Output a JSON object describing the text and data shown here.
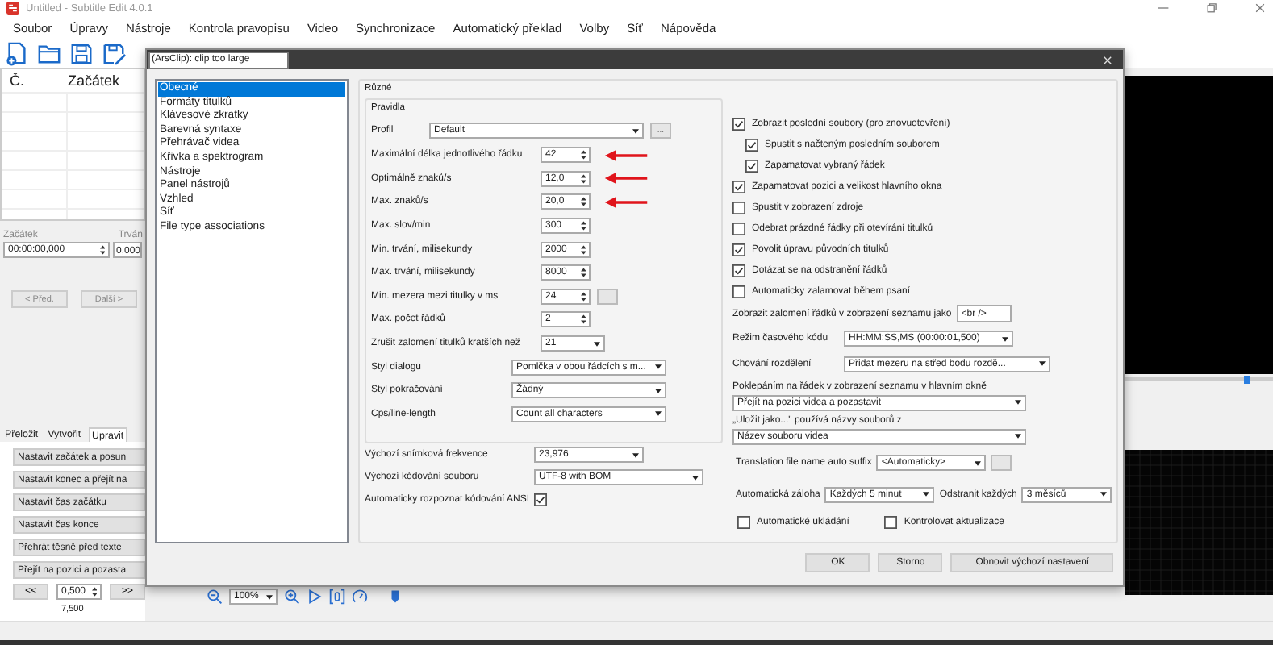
{
  "window": {
    "title": "Untitled - Subtitle Edit 4.0.1"
  },
  "menu": [
    "Soubor",
    "Úpravy",
    "Nástroje",
    "Kontrola pravopisu",
    "Video",
    "Synchronizace",
    "Automatický překlad",
    "Volby",
    "Síť",
    "Nápověda"
  ],
  "subtitle_list": {
    "columns": [
      "Č.",
      "Začátek"
    ]
  },
  "edit_panel": {
    "start_label": "Začátek",
    "duration_label": "Trván",
    "start_value": "00:00:00,000",
    "duration_value": "0,000",
    "buttons": [
      {
        "label": "< Před.",
        "disabled": true
      },
      {
        "label": "Další >",
        "disabled": true
      }
    ]
  },
  "tabs": [
    {
      "label": "Přeložit",
      "selected": false
    },
    {
      "label": "Vytvořit",
      "selected": false
    },
    {
      "label": "Upravit",
      "selected": true
    }
  ],
  "actions": [
    "Nastavit začátek a posun",
    "Nastavit konec a přejít na",
    "Nastavit čas začátku",
    "Nastavit čas konce",
    "Přehrát těsně před texte",
    "Přejít na pozici a pozasta"
  ],
  "nudge": {
    "back": "<<",
    "step": "0,500",
    "forward": ">>",
    "duration": "7,500"
  },
  "zoom": {
    "value": "100%"
  },
  "video_position": {
    "level": 0.8
  },
  "dialog": {
    "clipboard_tip": "(ArsClip): clip too large",
    "categories": [
      {
        "label": "Obecné",
        "selected": true
      },
      {
        "label": "Formáty titulků",
        "selected": false
      },
      {
        "label": "Klávesové zkratky",
        "selected": false
      },
      {
        "label": "Barevná syntaxe",
        "selected": false
      },
      {
        "label": "Přehrávač videa",
        "selected": false
      },
      {
        "label": "Křivka a spektrogram",
        "selected": false
      },
      {
        "label": "Nástroje",
        "selected": false
      },
      {
        "label": "Panel nástrojů",
        "selected": false
      },
      {
        "label": "Vzhled",
        "selected": false
      },
      {
        "label": "Síť",
        "selected": false
      },
      {
        "label": "File type associations",
        "selected": false
      }
    ],
    "group_title": "Různé",
    "rules": {
      "title": "Pravidla",
      "profile": {
        "label": "Profil",
        "value": "Default",
        "more": "..."
      },
      "fields": [
        {
          "kind": "spin",
          "label": "Maximální délka jednotlivého řádku",
          "value": "42",
          "marked": true
        },
        {
          "kind": "spin",
          "label": "Optimálně znaků/s",
          "value": "12,0",
          "marked": true
        },
        {
          "kind": "spin",
          "label": "Max. znaků/s",
          "value": "20,0",
          "marked": true
        },
        {
          "kind": "spin",
          "label": "Max. slov/min",
          "value": "300",
          "marked": false
        },
        {
          "kind": "spin",
          "label": "Min. trvání, milisekundy",
          "value": "2000",
          "marked": false
        },
        {
          "kind": "spin",
          "label": "Max. trvání, milisekundy",
          "value": "8000",
          "marked": false
        },
        {
          "kind": "spin",
          "label": "Min. mezera mezi titulky v ms",
          "value": "24",
          "marked": false,
          "more": "..."
        },
        {
          "kind": "spin",
          "label": "Max. počet řádků",
          "value": "2",
          "marked": false
        },
        {
          "kind": "short_select",
          "label": "Zrušit zalomení titulků kratších než",
          "value": "21",
          "marked": false
        },
        {
          "kind": "select",
          "label": "Styl dialogu",
          "value": "Pomlčka v obou řádcích s m...",
          "marked": false
        },
        {
          "kind": "select",
          "label": "Styl pokračování",
          "value": "Žádný",
          "marked": false
        },
        {
          "kind": "select",
          "label": "Cps/line-length",
          "value": "Count all characters",
          "marked": false
        }
      ]
    },
    "frame_rate": {
      "label": "Výchozí snímková frekvence",
      "value": "23,976"
    },
    "encoding": {
      "label": "Výchozí kódování souboru",
      "value": "UTF-8 with BOM"
    },
    "ansi": {
      "label": "Automaticky rozpoznat kódování ANSI",
      "checked": true
    },
    "options": [
      {
        "label": "Zobrazit poslední soubory (pro znovuotevření)",
        "checked": true,
        "children": [
          {
            "label": "Spustit s načteným posledním souborem",
            "checked": true
          },
          {
            "label": "Zapamatovat vybraný řádek",
            "checked": true
          }
        ]
      },
      {
        "label": "Zapamatovat pozici a velikost hlavního okna",
        "checked": true
      },
      {
        "label": "Spustit v zobrazení zdroje",
        "checked": false
      },
      {
        "label": "Odebrat prázdné řádky při otevírání titulků",
        "checked": false
      },
      {
        "label": "Povolit úpravu původních titulků",
        "checked": true
      },
      {
        "label": "Dotázat se na odstranění řádků",
        "checked": true
      },
      {
        "label": "Automaticky zalamovat během psaní",
        "checked": false
      }
    ],
    "line_break": {
      "label": "Zobrazit zalomení řádků v zobrazení seznamu jako",
      "value": "<br />"
    },
    "timecode": {
      "label": "Režim časového kódu",
      "value": "HH:MM:SS,MS (00:00:01,500)"
    },
    "split": {
      "label": "Chování rozdělení",
      "value": "Přidat mezeru na střed bodu rozdě..."
    },
    "double_click": {
      "label": "Poklepáním na řádek v zobrazení seznamu v hlavním okně",
      "value": "Přejít na pozici videa a pozastavit"
    },
    "save_as": {
      "label": "„Uložit jako...\" používá názvy souborů z",
      "value": "Název souboru videa"
    },
    "translation_suffix": {
      "label": "Translation file name auto suffix",
      "value": "<Automaticky>",
      "more": "..."
    },
    "backup": {
      "label": "Automatická záloha",
      "value": "Každých 5 minut"
    },
    "delete": {
      "label": "Odstranit každých",
      "value": "3 měsíců"
    },
    "auto_save": {
      "label": "Automatické ukládání",
      "checked": false
    },
    "check_updates": {
      "label": "Kontrolovat aktualizace",
      "checked": false
    },
    "buttons": [
      "OK",
      "Storno",
      "Obnovit výchozí nastavení"
    ]
  }
}
